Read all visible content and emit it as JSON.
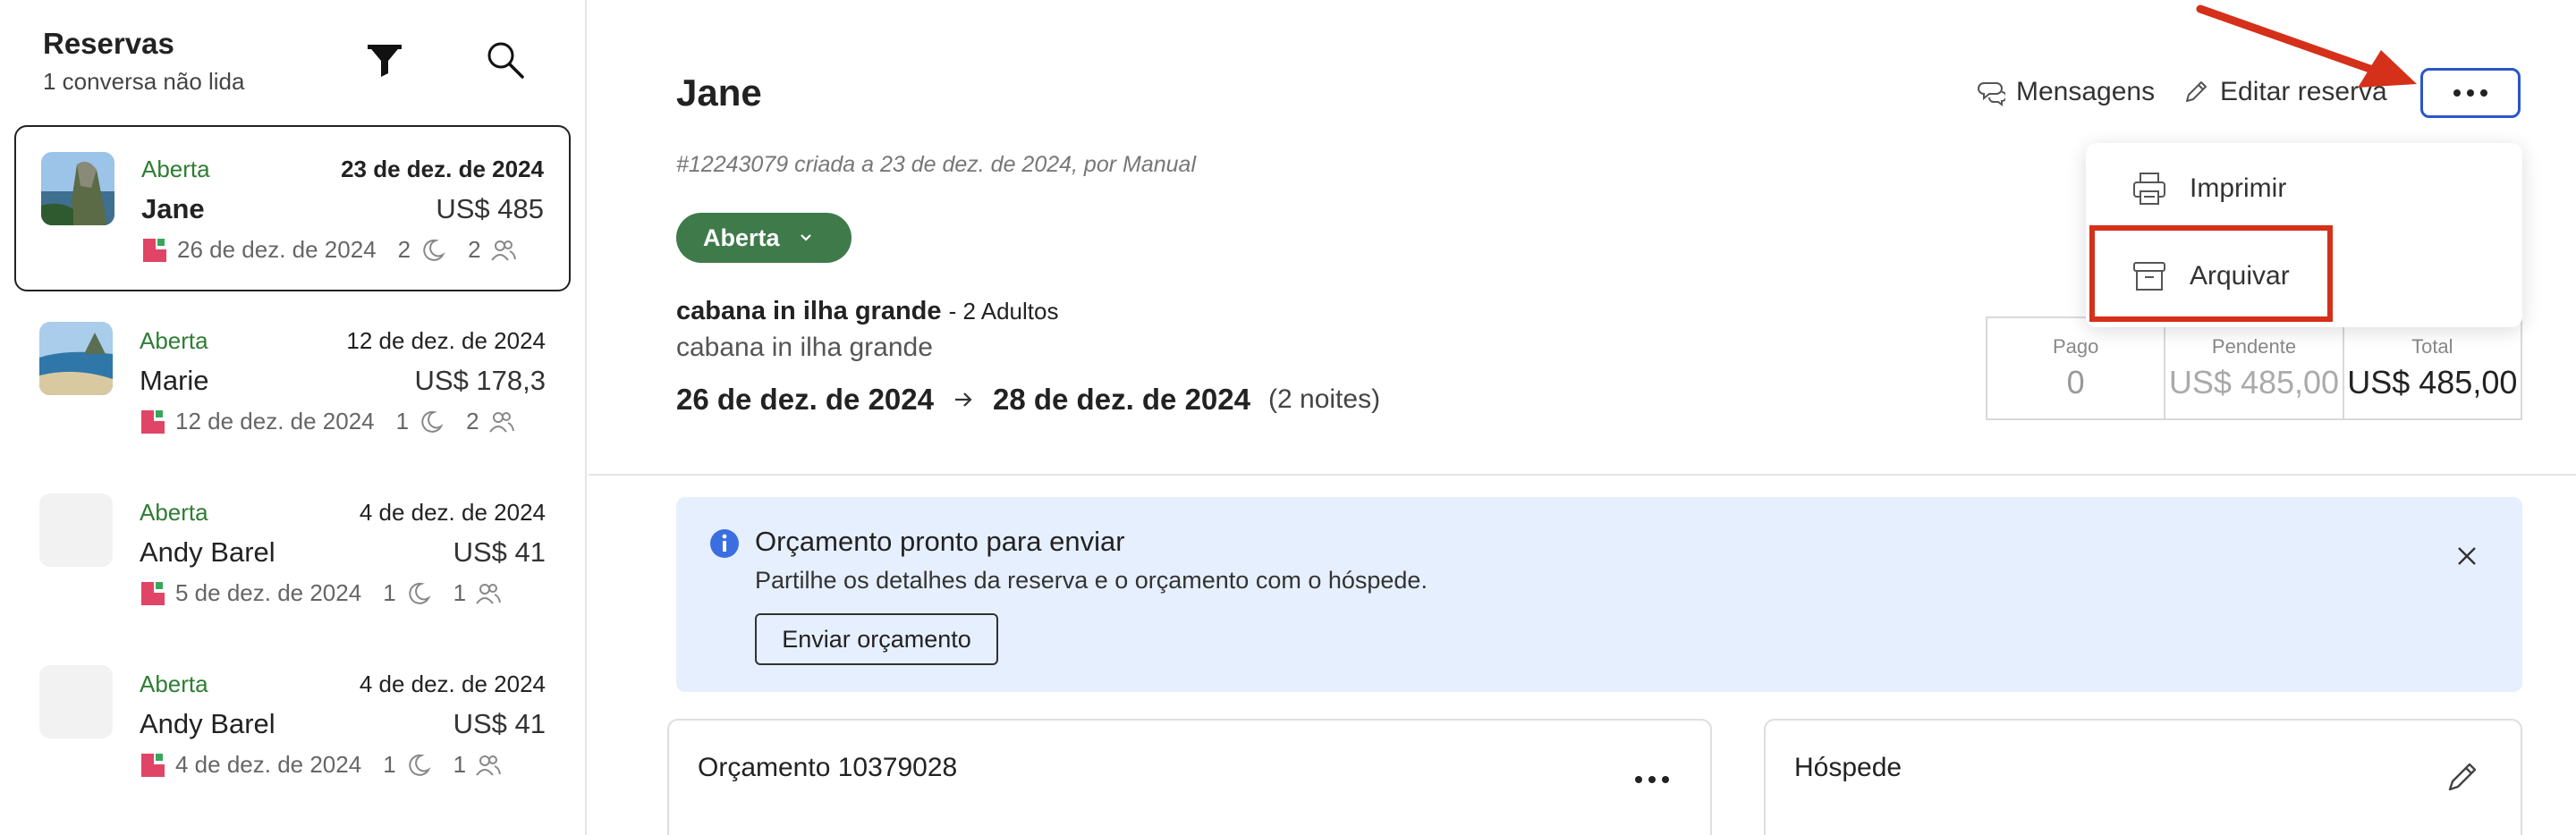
{
  "sidebar": {
    "title": "Reservas",
    "subtitle": "1 conversa não lida",
    "reservations": [
      {
        "status": "Aberta",
        "date": "23 de dez. de 2024",
        "name": "Jane",
        "price": "US$ 485",
        "checkin": "26 de dez. de 2024",
        "nights": "2",
        "guests": "2"
      },
      {
        "status": "Aberta",
        "date": "12 de dez. de 2024",
        "name": "Marie",
        "price": "US$ 178,3",
        "checkin": "12 de dez. de 2024",
        "nights": "1",
        "guests": "2"
      },
      {
        "status": "Aberta",
        "date": "4 de dez. de 2024",
        "name": "Andy Barel",
        "price": "US$ 41",
        "checkin": "5 de dez. de 2024",
        "nights": "1",
        "guests": "1"
      },
      {
        "status": "Aberta",
        "date": "4 de dez. de 2024",
        "name": "Andy Barel",
        "price": "US$ 41",
        "checkin": "4 de dez. de 2024",
        "nights": "1",
        "guests": "1"
      }
    ]
  },
  "reservation": {
    "guest_name": "Jane",
    "created_line": "#12243079 criada a 23 de dez. de 2024, por Manual",
    "status": "Aberta",
    "property_name": "cabana in ilha grande",
    "adults": "- 2 Adultos",
    "property_sub": "cabana in ilha grande",
    "checkin": "26 de dez. de 2024",
    "checkout": "28 de dez. de 2024",
    "nights": "(2 noites)"
  },
  "header": {
    "messages_label": "Mensagens",
    "edit_label": "Editar reserva"
  },
  "menu": {
    "print_label": "Imprimir",
    "archive_label": "Arquivar"
  },
  "payment": {
    "paid_label": "Pago",
    "paid_value": "0",
    "pending_label": "Pendente",
    "pending_value": "US$ 485,00",
    "total_label": "Total",
    "total_value": "US$ 485,00"
  },
  "banner": {
    "title": "Orçamento pronto para enviar",
    "text": "Partilhe os detalhes da reserva e o orçamento com o hóspede.",
    "button_label": "Enviar orçamento"
  },
  "panels": {
    "quote_title": "Orçamento 10379028",
    "guest_title": "Hóspede"
  },
  "colors": {
    "status_green": "#2e7d32",
    "pill_green": "#3f7a4b",
    "highlight_blue": "#2a56c6",
    "annotation_red": "#d4301a",
    "banner_bg": "#e6effd"
  }
}
